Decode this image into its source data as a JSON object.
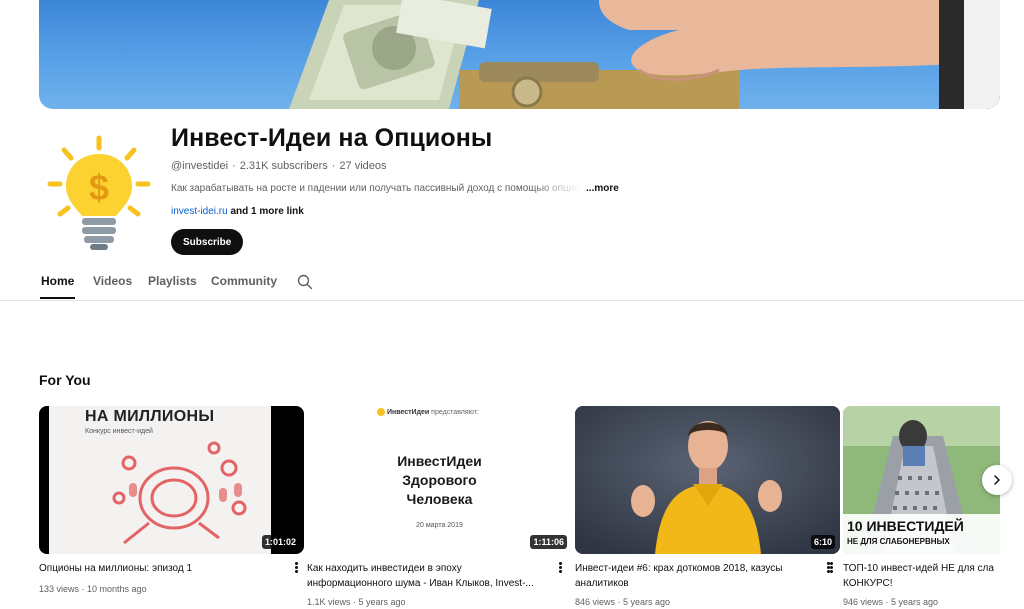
{
  "channel": {
    "name": "Инвест-Идеи на Опционы",
    "handle": "@investidei",
    "subscribers": "2.31K subscribers",
    "videos": "27 videos",
    "description": "Как зарабатывать на росте и падении или получать пассивный доход с помощью опционов",
    "more_label": "...more",
    "link": "invest-idei.ru",
    "more_links": "and 1 more link",
    "subscribe_label": "Subscribe"
  },
  "tabs": [
    {
      "label": "Home",
      "active": true
    },
    {
      "label": "Videos"
    },
    {
      "label": "Playlists"
    },
    {
      "label": "Community"
    }
  ],
  "section": {
    "title": "For You"
  },
  "videos": [
    {
      "title": "Опционы на миллионы: эпизод 1",
      "views": "133 views",
      "age": "10 months ago",
      "duration": "1:01:02",
      "thumb_heading": "НА МИЛЛИОНЫ",
      "thumb_sub": "Конкурс инвест-идей"
    },
    {
      "title": "Как находить инвестидеи в эпоху информационного шума - Иван Клыков, Invest-...",
      "views": "1.1K views",
      "age": "5 years ago",
      "duration": "1:11:06",
      "thumb_brand": "ИнвестИдеи",
      "thumb_presents": "представляют:",
      "thumb_heading_1": "ИнвестИдеи",
      "thumb_heading_2": "Здорового",
      "thumb_heading_3": "Человека",
      "thumb_date": "20 марта 2019"
    },
    {
      "title": "Инвест-идеи #6: крах доткомов 2018, казусы аналитиков",
      "views": "846 views",
      "age": "5 years ago",
      "duration": "6:10"
    },
    {
      "title": "ТОП-10 инвест-идей НЕ для сла КОНКУРС!",
      "views": "946 views",
      "age": "5 years ago",
      "thumb_heading": "10 ИНВЕСТИДЕЙ",
      "thumb_sub": "НЕ ДЛЯ СЛАБОНЕРВНЫХ"
    }
  ],
  "colors": {
    "accent": "#0f0f0f",
    "link": "#065fd4",
    "muted": "#606060"
  },
  "icons": [
    "search-icon",
    "chevron-right-icon",
    "more-vert-icon",
    "lightbulb-dollar-icon"
  ]
}
